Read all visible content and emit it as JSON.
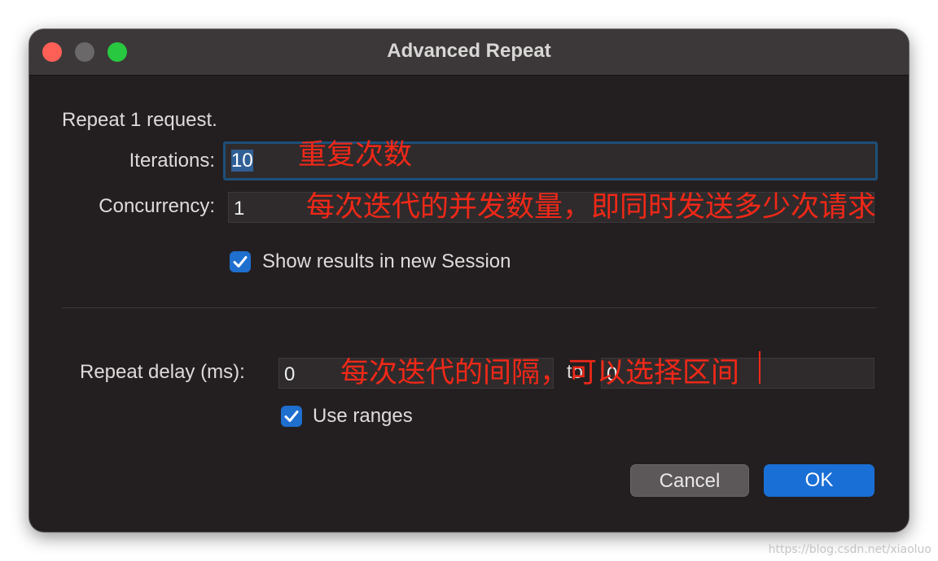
{
  "window": {
    "title": "Advanced Repeat"
  },
  "dialog": {
    "description": "Repeat 1 request.",
    "iterations": {
      "label": "Iterations:",
      "value": "10"
    },
    "concurrency": {
      "label": "Concurrency:",
      "value": "1"
    },
    "show_results": {
      "label": "Show results in new Session",
      "checked": true
    },
    "repeat_delay": {
      "label": "Repeat delay (ms):",
      "from_value": "0",
      "to_label": "to",
      "to_value": "0"
    },
    "use_ranges": {
      "label": "Use ranges",
      "checked": true
    },
    "cancel_label": "Cancel",
    "ok_label": "OK"
  },
  "annotations": {
    "iterations_note": "重复次数",
    "concurrency_note": "每次迭代的并发数量，即同时发送多少次请求",
    "delay_note": "每次迭代的间隔，可以选择区间"
  },
  "watermark": "https://blog.csdn.net/xiaoluo",
  "colors": {
    "window_bg": "#231f20",
    "titlebar_bg": "#3c3839",
    "accent": "#1a6fd6",
    "annotation": "#f02818",
    "close": "#fe5f57",
    "minimize": "#6b6869",
    "maximize": "#28c840"
  }
}
